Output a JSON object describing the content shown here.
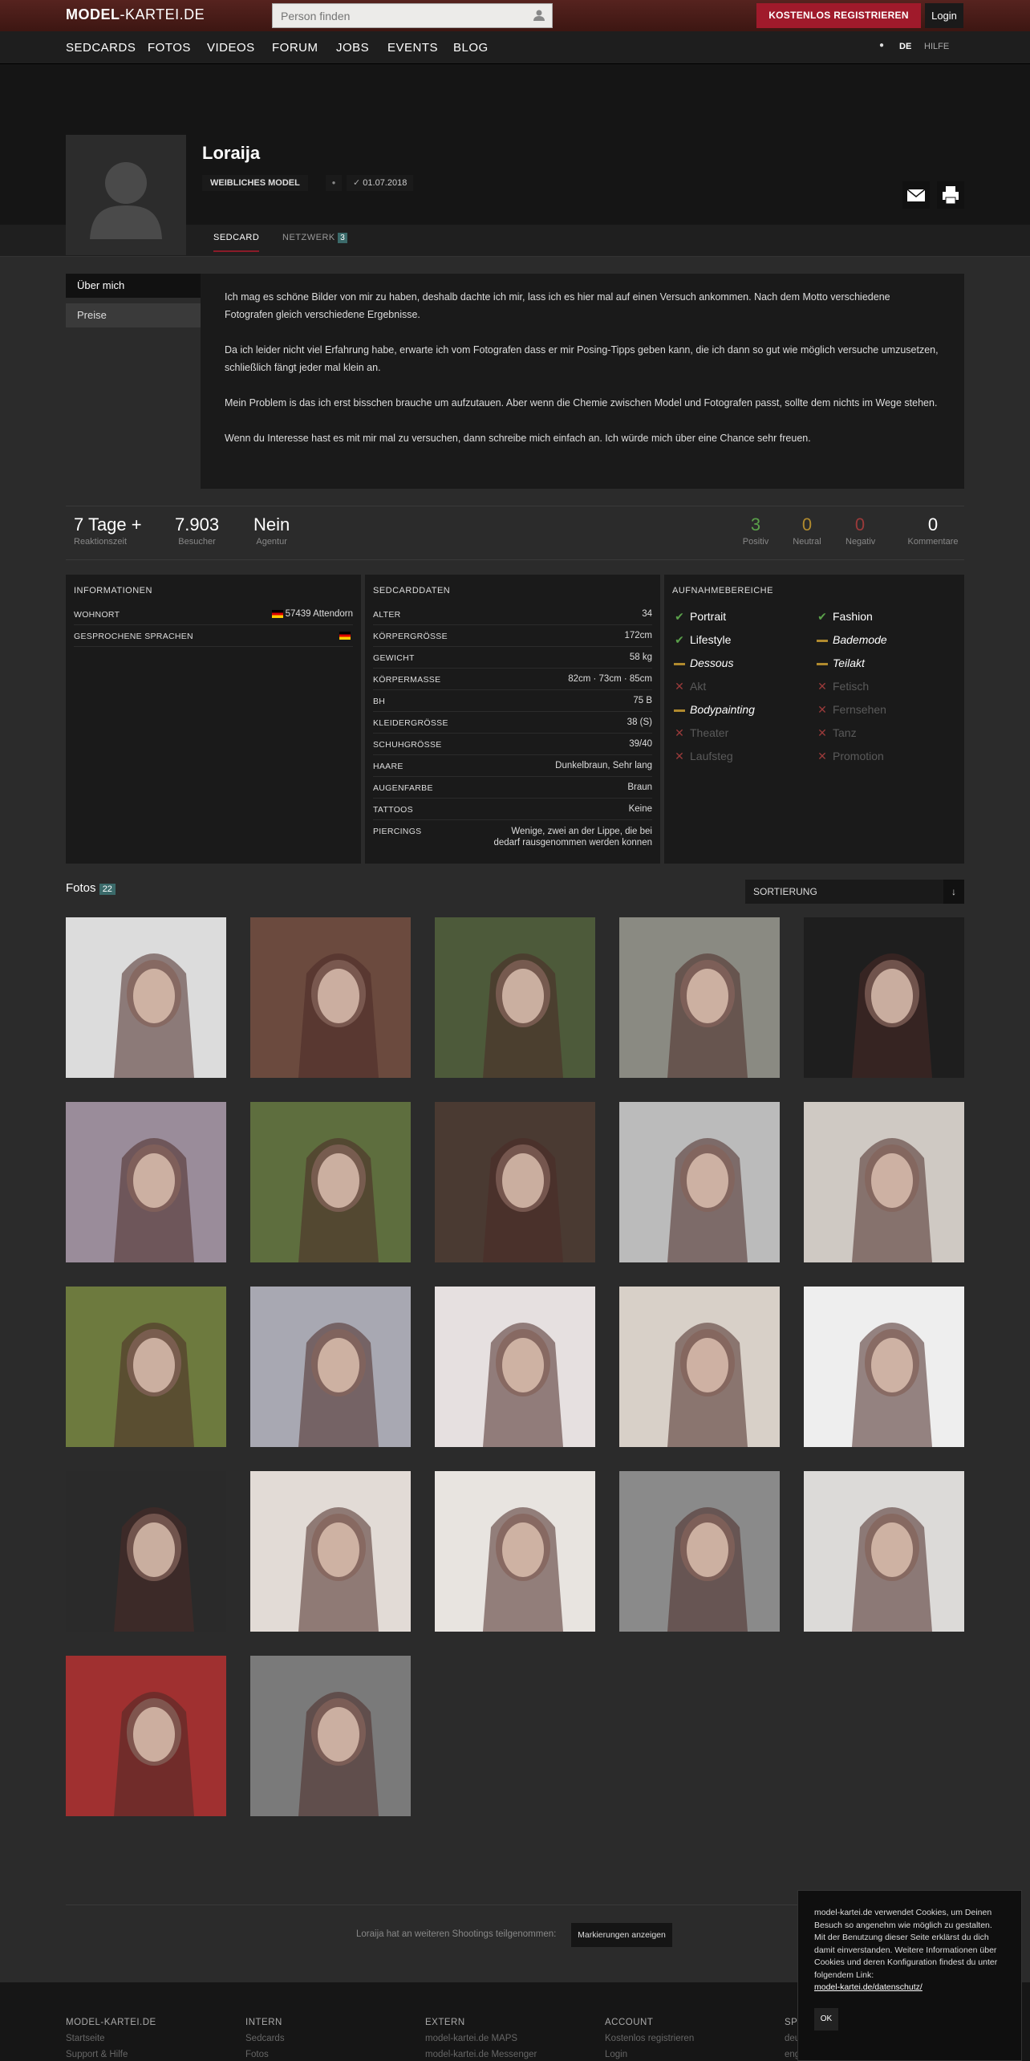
{
  "header": {
    "logo_bold": "MODEL",
    "logo_rest": "-KARTEI.DE",
    "search_placeholder": "Person finden",
    "register_label": "KOSTENLOS REGISTRIEREN",
    "login_label": "Login"
  },
  "nav": {
    "items": [
      "SEDCARDS",
      "FOTOS",
      "VIDEOS",
      "FORUM",
      "JOBS",
      "EVENTS",
      "BLOG"
    ],
    "lang": "DE",
    "help": "HILFE"
  },
  "profile": {
    "name": "Loraija",
    "role": "WEIBLICHES MODEL",
    "date": "01.07.2018",
    "tabs": {
      "sedcard": "SEDCARD",
      "network": "NETZWERK",
      "network_count": "3"
    }
  },
  "sidebar": {
    "about": "Über mich",
    "prices": "Preise"
  },
  "about": {
    "paragraphs": [
      "Ich mag es schöne Bilder von mir zu haben, deshalb dachte ich mir, lass ich es hier mal auf einen Versuch ankommen. Nach dem Motto verschiedene Fotografen gleich verschiedene Ergebnisse.",
      "Da ich leider nicht viel Erfahrung habe, erwarte ich vom Fotografen dass er mir Posing-Tipps geben kann, die ich dann so gut wie möglich versuche umzusetzen, schließlich fängt jeder mal klein an.",
      "Mein Problem is das ich erst bisschen brauche um aufzutauen. Aber wenn die Chemie zwischen Model und Fotografen passt, sollte dem nichts im Wege stehen.",
      "Wenn du Interesse hast es mit mir mal zu versuchen, dann schreibe mich einfach an. Ich würde mich über eine Chance sehr freuen."
    ]
  },
  "stats": {
    "reaction_value": "7 Tage +",
    "reaction_label": "Reaktionszeit",
    "visitors_value": "7.903",
    "visitors_label": "Besucher",
    "agency_value": "Nein",
    "agency_label": "Agentur",
    "positive_value": "3",
    "positive_label": "Positiv",
    "neutral_value": "0",
    "neutral_label": "Neutral",
    "negative_value": "0",
    "negative_label": "Negativ",
    "comments_value": "0",
    "comments_label": "Kommentare",
    "positive_color": "#5aa04a",
    "neutral_color": "#b08a2e",
    "negative_color": "#9a3a3a"
  },
  "info": {
    "title": "INFORMATIONEN",
    "rows": [
      {
        "key": "WOHNORT",
        "value": "57439 Attendorn"
      },
      {
        "key": "GESPROCHENE SPRACHEN",
        "value": ""
      }
    ]
  },
  "sedcard": {
    "title": "SEDCARDDATEN",
    "rows": [
      {
        "key": "ALTER",
        "value": "34"
      },
      {
        "key": "KÖRPERGRÖSSE",
        "value": "172cm"
      },
      {
        "key": "GEWICHT",
        "value": "58 kg"
      },
      {
        "key": "KÖRPERMASSE",
        "value": "82cm · 73cm · 85cm"
      },
      {
        "key": "BH",
        "value": "75 B"
      },
      {
        "key": "KLEIDERGRÖSSE",
        "value": "38 (S)"
      },
      {
        "key": "SCHUHGRÖSSE",
        "value": "39/40"
      },
      {
        "key": "HAARE",
        "value": "Dunkelbraun, Sehr lang"
      },
      {
        "key": "AUGENFARBE",
        "value": "Braun"
      },
      {
        "key": "TATTOOS",
        "value": "Keine"
      },
      {
        "key": "PIERCINGS",
        "value": "Wenige, zwei an der Lippe, die bei dedarf rausgenommen werden konnen"
      }
    ]
  },
  "areas": {
    "title": "AUFNAHMEBEREICHE",
    "items": [
      {
        "label": "Portrait",
        "state": "on"
      },
      {
        "label": "Fashion",
        "state": "on"
      },
      {
        "label": "Lifestyle",
        "state": "on"
      },
      {
        "label": "Bademode",
        "state": "part"
      },
      {
        "label": "Dessous",
        "state": "part"
      },
      {
        "label": "Teilakt",
        "state": "part"
      },
      {
        "label": "Akt",
        "state": "off"
      },
      {
        "label": "Fetisch",
        "state": "off"
      },
      {
        "label": "Bodypainting",
        "state": "part"
      },
      {
        "label": "Fernsehen",
        "state": "off"
      },
      {
        "label": "Theater",
        "state": "off"
      },
      {
        "label": "Tanz",
        "state": "off"
      },
      {
        "label": "Laufsteg",
        "state": "off"
      },
      {
        "label": "Promotion",
        "state": "off"
      }
    ]
  },
  "photos": {
    "title": "Fotos",
    "count": "22",
    "sort_label": "SORTIERUNG",
    "tones": [
      "#dcdcdc",
      "#6b4a3e",
      "#4d5a3a",
      "#8a8a82",
      "#1e1e1e",
      "#9a8c9a",
      "#5e6e3e",
      "#4a3a32",
      "#bbbbbb",
      "#cfc9c3",
      "#6d7a3e",
      "#a8a8b2",
      "#e6e0e0",
      "#d8d0c8",
      "#eeeeee",
      "#2a2a2a",
      "#e2dbd6",
      "#e8e4e0",
      "#8a8a8a",
      "#dcdad8",
      "#a03030",
      "#7a7a7a"
    ]
  },
  "footer": {
    "shootings_text": "Loraija hat an weiteren Shootings teilgenommen:",
    "shootings_button": "Markierungen anzeigen",
    "cols": [
      {
        "head": "MODEL-KARTEI.DE",
        "items": [
          "Startseite",
          "Support & Hilfe"
        ]
      },
      {
        "head": "INTERN",
        "items": [
          "Sedcards",
          "Fotos"
        ]
      },
      {
        "head": "EXTERN",
        "items": [
          "model-kartei.de MAPS",
          "model-kartei.de Messenger"
        ]
      },
      {
        "head": "ACCOUNT",
        "items": [
          "Kostenlos registrieren",
          "Login"
        ]
      },
      {
        "head": "SPRACHE",
        "items": [
          "deutsch",
          "english"
        ]
      }
    ]
  },
  "cookie": {
    "text": "model-kartei.de verwendet Cookies, um Deinen Besuch so angenehm wie möglich zu gestalten. Mit der Benutzung dieser Seite erklärst du dich damit einverstanden. Weitere Informationen über Cookies und deren Konfiguration findest du unter folgendem Link:",
    "link": "model-kartei.de/datenschutz/",
    "ok": "OK"
  }
}
